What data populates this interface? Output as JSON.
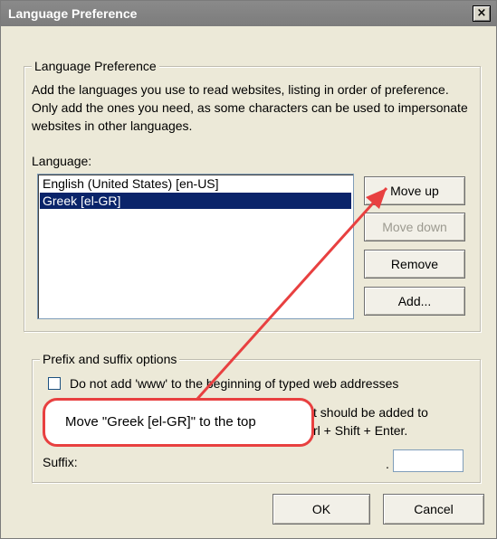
{
  "window": {
    "title": "Language Preference",
    "close_glyph": "×"
  },
  "language_group": {
    "legend": "Language Preference",
    "description": "Add the languages you use to read websites, listing in order of preference. Only add the ones you need, as some characters can be used to impersonate websites in other languages.",
    "list_label": "Language:",
    "languages": [
      {
        "label": "English (United States) [en-US]",
        "selected": false
      },
      {
        "label": "Greek [el-GR]",
        "selected": true
      }
    ],
    "buttons": {
      "move_up": "Move up",
      "move_down": "Move down",
      "remove": "Remove",
      "add": "Add..."
    }
  },
  "prefix_group": {
    "legend": "Prefix and suffix options",
    "checkbox_label": "Do not add 'www' to the beginning of typed web addresses",
    "hint_fragment_1": "t should be added to",
    "hint_fragment_2": "rl + Shift + Enter.",
    "suffix_label": "Suffix:",
    "suffix_dot": ".",
    "suffix_value": ""
  },
  "footer": {
    "ok": "OK",
    "cancel": "Cancel"
  },
  "annotation": {
    "text": "Move \"Greek [el-GR]\" to the top",
    "color": "#e84040"
  }
}
